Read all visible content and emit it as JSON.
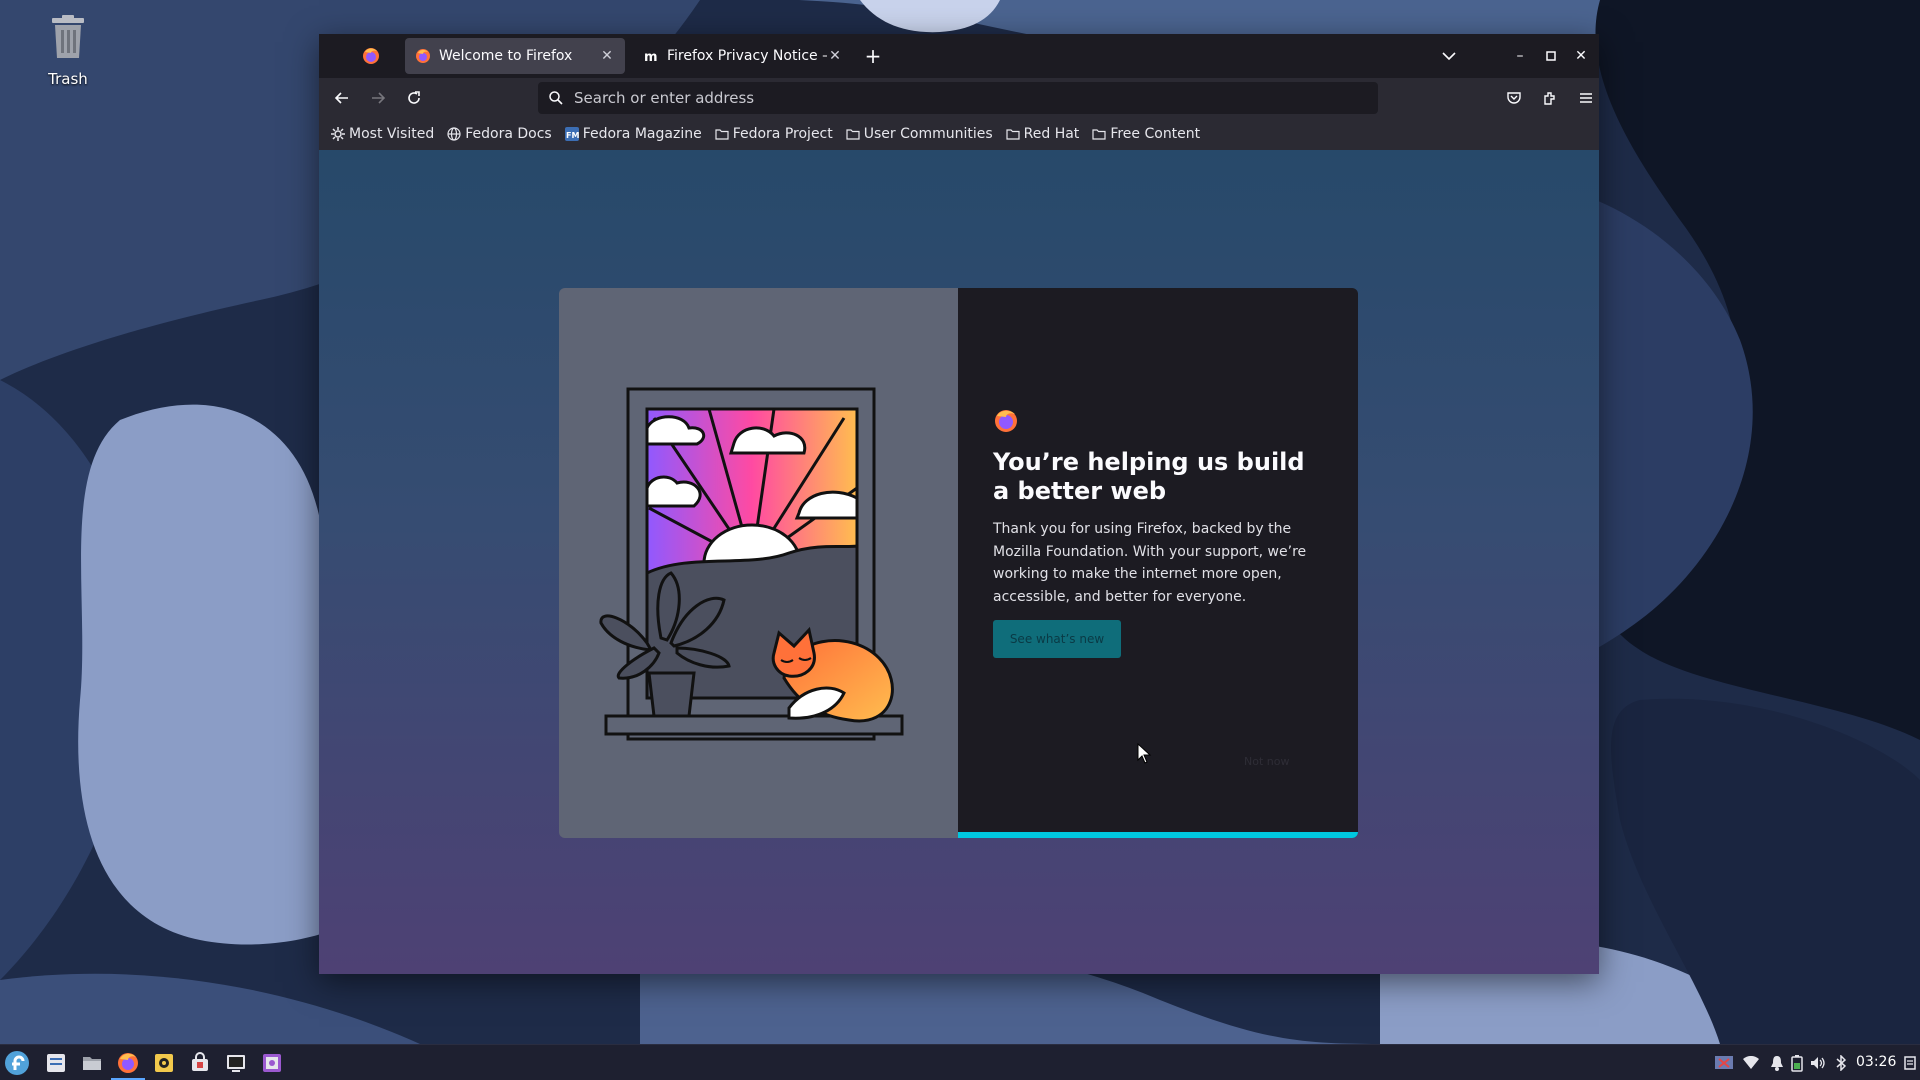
{
  "desktop": {
    "trash_label": "Trash"
  },
  "browser": {
    "tabs": [
      {
        "title": "Welcome to Firefox",
        "active": true
      },
      {
        "title": "Firefox Privacy Notice — M",
        "active": false
      }
    ],
    "url_placeholder": "Search or enter address",
    "bookmarks": [
      {
        "label": "Most Visited",
        "icon": "gear-icon"
      },
      {
        "label": "Fedora Docs",
        "icon": "globe-icon"
      },
      {
        "label": "Fedora Magazine",
        "icon": "fm-icon"
      },
      {
        "label": "Fedora Project",
        "icon": "folder-icon"
      },
      {
        "label": "User Communities",
        "icon": "folder-icon"
      },
      {
        "label": "Red Hat",
        "icon": "folder-icon"
      },
      {
        "label": "Free Content",
        "icon": "folder-icon"
      }
    ]
  },
  "welcome": {
    "title": "You’re helping us build a better web",
    "body": "Thank you for using Firefox, backed by the Mozilla Foundation. With your support, we’re working to make the internet more open, accessible, and better for everyone.",
    "primary_button": "See what’s new",
    "skip_label": "Not now",
    "progress": 1.0
  },
  "taskbar": {
    "clock": "03:26"
  },
  "colors": {
    "accent": "#00c8e0",
    "button": "#0f6d7a"
  }
}
